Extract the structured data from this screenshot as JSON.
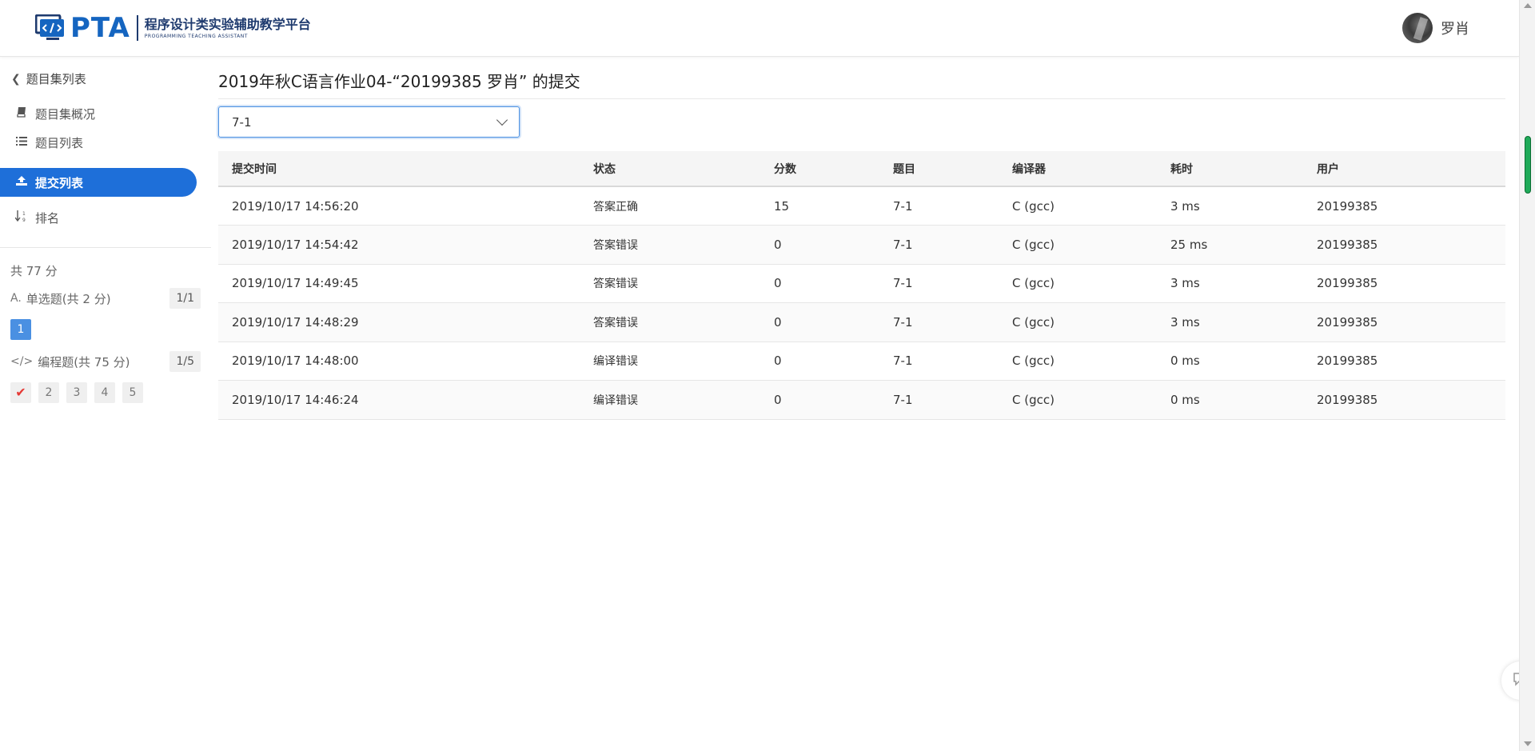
{
  "header": {
    "logo_text": "PTA",
    "logo_cn": "程序设计类实验辅助教学平台",
    "logo_en": "PROGRAMMING TEACHING ASSISTANT",
    "user_name": "罗肖"
  },
  "sidebar": {
    "back_label": "题目集列表",
    "nav": [
      {
        "label": "题目集概况",
        "icon": "book-icon"
      },
      {
        "label": "题目列表",
        "icon": "list-icon"
      },
      {
        "label": "提交列表",
        "icon": "upload-icon",
        "active": true
      },
      {
        "label": "排名",
        "icon": "sort-numeric-icon"
      }
    ],
    "total": "共 77 分",
    "sections": [
      {
        "icon_text": "A.",
        "label": "单选题(共 2 分)",
        "count": "1/1",
        "questions": [
          "1"
        ]
      },
      {
        "icon_text": "</>",
        "label": "编程题(共 75 分)",
        "count": "1/5",
        "questions": [
          "✔",
          "2",
          "3",
          "4",
          "5"
        ]
      }
    ]
  },
  "main": {
    "title": "2019年秋C语言作业04-“20199385 罗肖” 的提交",
    "select_value": "7-1",
    "columns": [
      "提交时间",
      "状态",
      "分数",
      "题目",
      "编译器",
      "耗时",
      "用户"
    ],
    "rows": [
      {
        "time": "2019/10/17 14:56:20",
        "status": "答案正确",
        "score": "15",
        "problem": "7-1",
        "compiler": "C (gcc)",
        "cost": "3 ms",
        "user": "20199385"
      },
      {
        "time": "2019/10/17 14:54:42",
        "status": "答案错误",
        "score": "0",
        "problem": "7-1",
        "compiler": "C (gcc)",
        "cost": "25 ms",
        "user": "20199385"
      },
      {
        "time": "2019/10/17 14:49:45",
        "status": "答案错误",
        "score": "0",
        "problem": "7-1",
        "compiler": "C (gcc)",
        "cost": "3 ms",
        "user": "20199385"
      },
      {
        "time": "2019/10/17 14:48:29",
        "status": "答案错误",
        "score": "0",
        "problem": "7-1",
        "compiler": "C (gcc)",
        "cost": "3 ms",
        "user": "20199385"
      },
      {
        "time": "2019/10/17 14:48:00",
        "status": "编译错误",
        "score": "0",
        "problem": "7-1",
        "compiler": "C (gcc)",
        "cost": "0 ms",
        "user": "20199385"
      },
      {
        "time": "2019/10/17 14:46:24",
        "status": "编译错误",
        "score": "0",
        "problem": "7-1",
        "compiler": "C (gcc)",
        "cost": "0 ms",
        "user": "20199385"
      }
    ]
  },
  "colors": {
    "primary": "#1e6fd9",
    "accepted": "#e53935",
    "wrong_answer": "#2e9b2e",
    "compile_error": "#3a7bd5"
  }
}
